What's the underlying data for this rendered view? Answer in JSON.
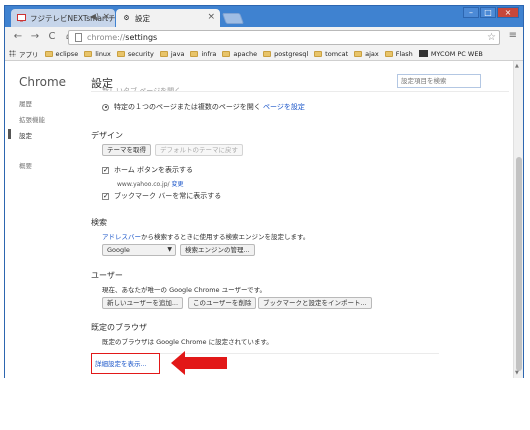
{
  "tabs": [
    {
      "label": "フジテレビNEXTsmartチャ",
      "favicon": "tv-icon"
    },
    {
      "label": "設定",
      "favicon": "gear-icon"
    }
  ],
  "toolbar": {
    "url_scheme": "chrome://",
    "url_path": "settings",
    "back": "←",
    "forward": "→",
    "reload": "C",
    "home": "⌂",
    "star": "☆",
    "menu": "≡"
  },
  "bookmarks": [
    {
      "label": "アプリ",
      "icon": "apps-icon"
    },
    {
      "label": "eclipse",
      "icon": "folder-icon"
    },
    {
      "label": "linux",
      "icon": "folder-icon"
    },
    {
      "label": "security",
      "icon": "folder-icon"
    },
    {
      "label": "java",
      "icon": "folder-icon"
    },
    {
      "label": "infra",
      "icon": "folder-icon"
    },
    {
      "label": "apache",
      "icon": "folder-icon"
    },
    {
      "label": "postgresql",
      "icon": "folder-icon"
    },
    {
      "label": "tomcat",
      "icon": "folder-icon"
    },
    {
      "label": "ajax",
      "icon": "folder-icon"
    },
    {
      "label": "Flash",
      "icon": "folder-icon"
    },
    {
      "label": "MYCOM PC WEB",
      "icon": "mycom-icon"
    }
  ],
  "sidebar": {
    "title": "Chrome",
    "items": [
      "履歴",
      "拡張機能",
      "設定",
      "概要"
    ]
  },
  "main": {
    "title": "設定",
    "search_placeholder": "設定項目を検索",
    "startup_cut_text": "新しいタブ ページを開く",
    "startup_radio_text": "特定の１つのページまたは複数のページを開く",
    "startup_link": "ページを設定",
    "design": {
      "title": "デザイン",
      "get_themes": "テーマを取得",
      "reset_theme": "デフォルトのテーマに戻す",
      "show_home": "ホーム ボタンを表示する",
      "home_url": "www.yahoo.co.jp/",
      "change": "変更",
      "show_bookmarks": "ブックマーク バーを常に表示する"
    },
    "search": {
      "title": "検索",
      "link": "アドレスバー",
      "text": "から検索するときに使用する検索エンジンを設定します。",
      "engine": "Google",
      "manage": "検索エンジンの管理..."
    },
    "users": {
      "title": "ユーザー",
      "text": "現在、あなたが唯一の Google Chrome ユーザーです。",
      "add": "新しいユーザーを追加...",
      "delete": "このユーザーを削除",
      "import": "ブックマークと設定をインポート..."
    },
    "default_browser": {
      "title": "既定のブラウザ",
      "text": "既定のブラウザは Google Chrome に設定されています。"
    },
    "advanced_link": "詳細設定を表示..."
  },
  "colors": {
    "window_frame": "#3f82d0",
    "link": "#1a55c9",
    "highlight_red": "#e21818"
  }
}
